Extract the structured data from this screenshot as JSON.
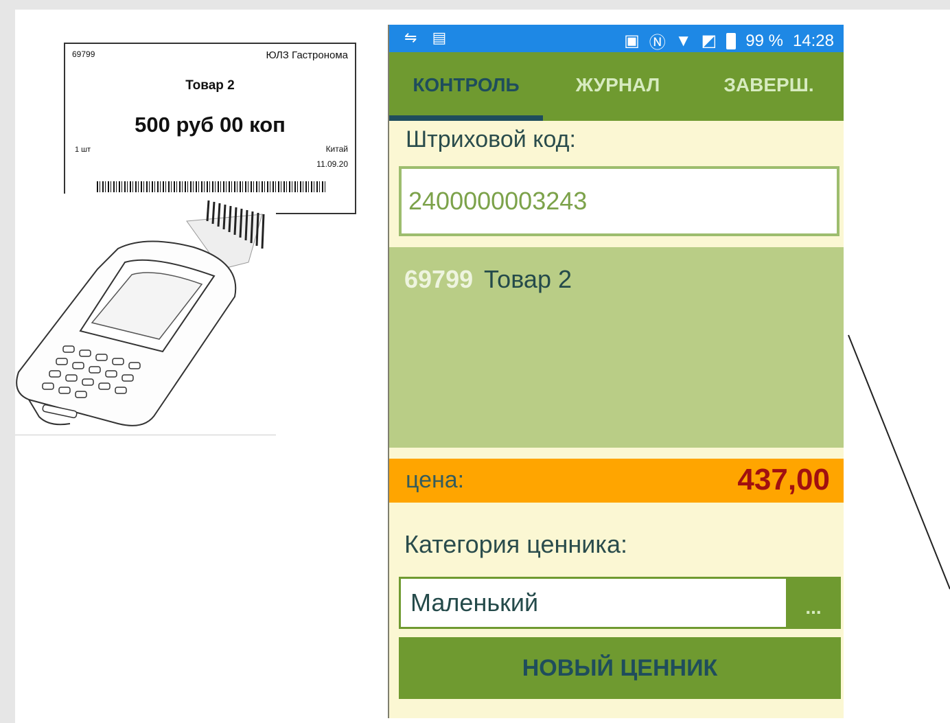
{
  "price_tag": {
    "code": "69799",
    "store": "ЮЛЗ Гастронома",
    "name": "Товар 2",
    "price": "500 руб 00 коп",
    "qty": "1 шт",
    "country": "Китай",
    "date": "11.09.20"
  },
  "statusbar": {
    "battery": "99 %",
    "time": "14:28"
  },
  "tabs": [
    {
      "label": "КОНТРОЛЬ",
      "active": true
    },
    {
      "label": "ЖУРНАЛ",
      "active": false
    },
    {
      "label": "ЗАВЕРШ.",
      "active": false
    }
  ],
  "form": {
    "barcode_label": "Штриховой код:",
    "barcode_value": "2400000003243",
    "item_code": "69799",
    "item_name": "Товар 2",
    "price_label": "цена:",
    "price_value": "437,00",
    "category_label": "Категория ценника:",
    "category_value": "Маленький",
    "more_label": "...",
    "new_tag_label": "НОВЫЙ ЦЕННИК"
  },
  "colors": {
    "statusbar": "#1e88e5",
    "tabbar": "#6f9a30",
    "background": "#fbf7d3",
    "item_panel": "#b9cd86",
    "price_row": "#ffa500",
    "price_value": "#a11010"
  }
}
